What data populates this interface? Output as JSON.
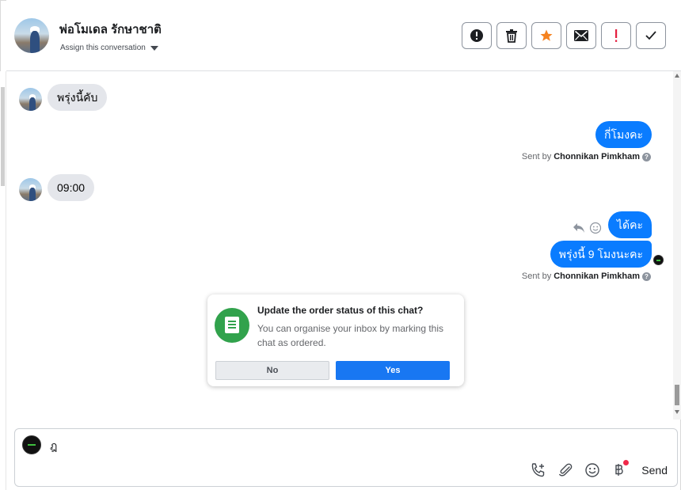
{
  "header": {
    "title": "พ่อโมเดล รักษาชาติ",
    "assign_label": "Assign this conversation"
  },
  "actions": [
    {
      "name": "mark-spam-button",
      "icon": "exclamation-circle-icon"
    },
    {
      "name": "delete-button",
      "icon": "trash-icon"
    },
    {
      "name": "follow-up-button",
      "icon": "star-icon"
    },
    {
      "name": "mark-unread-button",
      "icon": "envelope-icon"
    },
    {
      "name": "flag-button",
      "icon": "exclamation-icon"
    },
    {
      "name": "mark-done-button",
      "icon": "checkmark-icon"
    }
  ],
  "messages": [
    {
      "dir": "in",
      "text": "พรุ่งนี้คับ"
    },
    {
      "dir": "out",
      "text": "กี่โมงคะ",
      "sent_by_prefix": "Sent by",
      "sent_by_name": "Chonnikan Pimkham"
    },
    {
      "dir": "in",
      "text": "09:00"
    },
    {
      "dir": "out",
      "text": "ได้คะ"
    },
    {
      "dir": "out",
      "text": "พรุ่งนี้ 9 โมงนะคะ",
      "sent_by_prefix": "Sent by",
      "sent_by_name": "Chonnikan Pimkham"
    }
  ],
  "order_prompt": {
    "title": "Update the order status of this chat?",
    "description": "You can organise your inbox by marking this chat as ordered.",
    "no_label": "No",
    "yes_label": "Yes"
  },
  "composer": {
    "value": "ฎ",
    "send_label": "Send",
    "tools": [
      "call-add-icon",
      "paperclip-icon",
      "emoji-icon",
      "baht-icon"
    ]
  },
  "colors": {
    "outgoing_bubble": "#0a7cff",
    "incoming_bubble": "#e4e6eb",
    "accent_green": "#31a24c",
    "yes_button": "#1877f2",
    "star": "#f5821f",
    "flag": "#e41e3f"
  }
}
